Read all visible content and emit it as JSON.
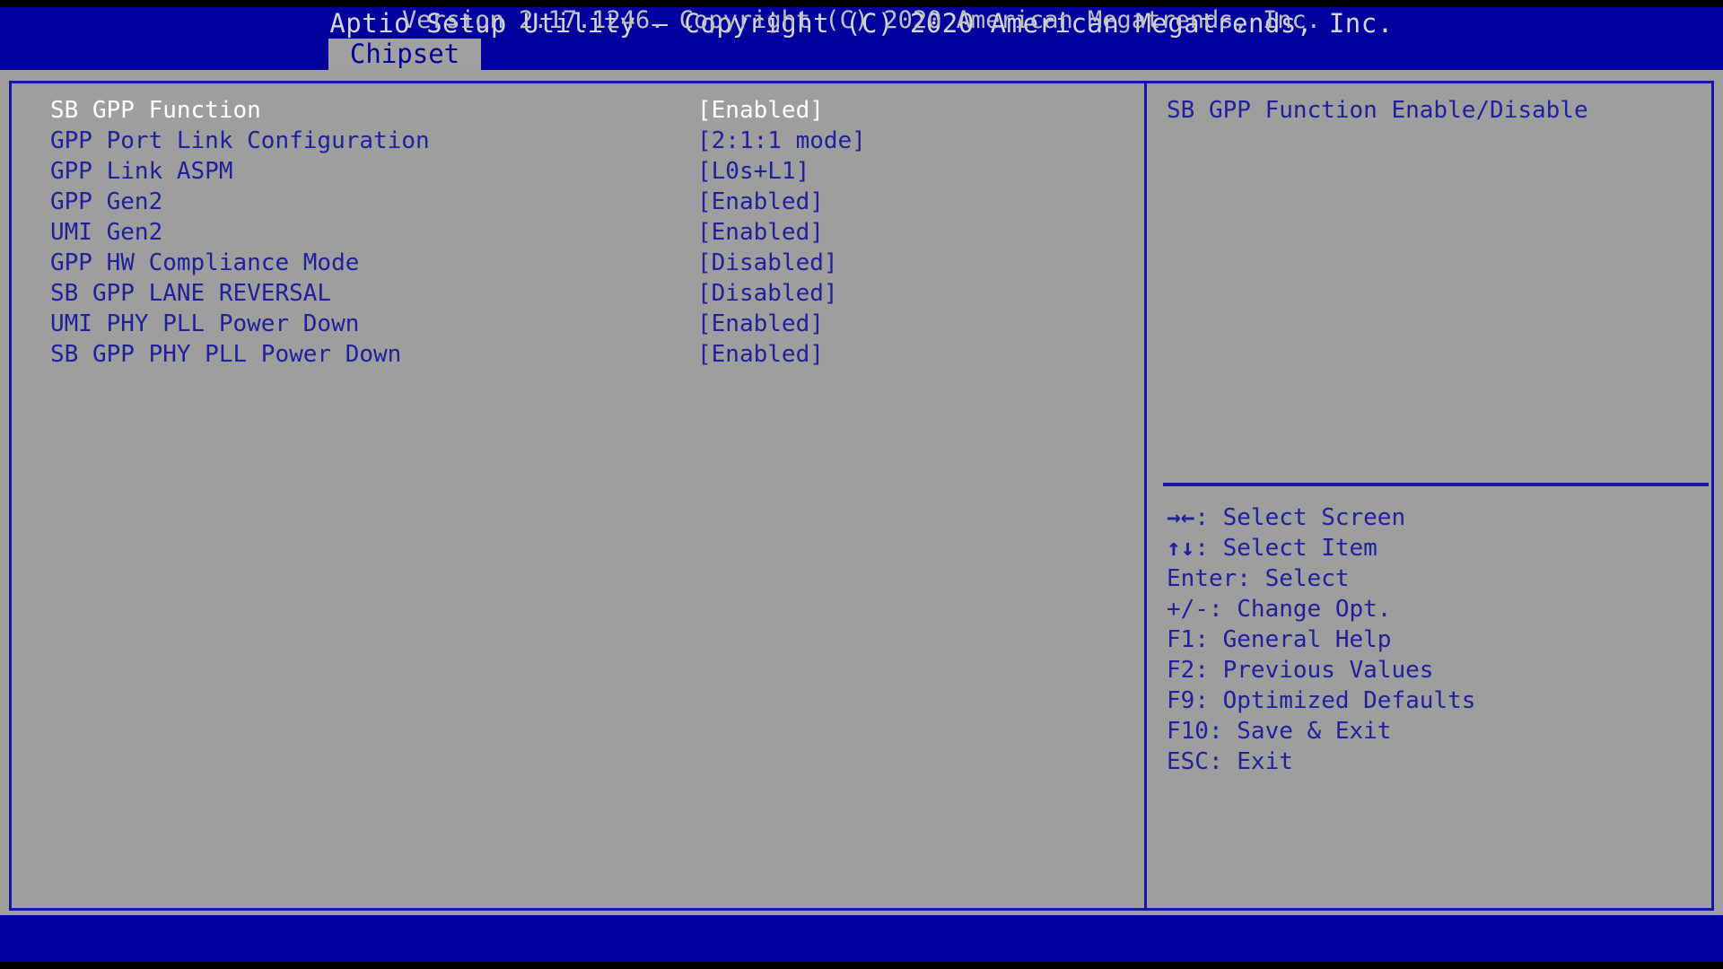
{
  "window": {
    "title": "Aptio Setup Utility – Copyright (C) 2020 American Megatrends, Inc."
  },
  "colors": {
    "header_blue": "#00009c",
    "body_gray": "#9e9e9e",
    "text_blue": "#20209c",
    "selected_white": "#ffffff",
    "tab_gray": "#a0a0a0",
    "border_blue": "#1515a8"
  },
  "tabs": [
    {
      "label": "Chipset",
      "active": true
    }
  ],
  "settings": [
    {
      "label": "SB GPP Function",
      "value": "[Enabled]",
      "selected": true
    },
    {
      "label": "GPP Port Link Configuration",
      "value": "[2:1:1 mode]",
      "selected": false
    },
    {
      "label": "GPP Link ASPM",
      "value": "[L0s+L1]",
      "selected": false
    },
    {
      "label": "GPP Gen2",
      "value": "[Enabled]",
      "selected": false
    },
    {
      "label": "UMI Gen2",
      "value": "[Enabled]",
      "selected": false
    },
    {
      "label": "GPP HW Compliance Mode",
      "value": "[Disabled]",
      "selected": false
    },
    {
      "label": "SB GPP LANE REVERSAL",
      "value": "[Disabled]",
      "selected": false
    },
    {
      "label": "UMI PHY PLL Power Down",
      "value": "[Enabled]",
      "selected": false
    },
    {
      "label": "SB GPP PHY PLL Power Down",
      "value": "[Enabled]",
      "selected": false
    }
  ],
  "help": {
    "text": "SB GPP Function Enable/Disable"
  },
  "legend": [
    {
      "key": "→←",
      "label": ": Select Screen"
    },
    {
      "key": "↑↓",
      "label": ": Select Item"
    },
    {
      "key": "Enter",
      "label": ": Select"
    },
    {
      "key": "+/-",
      "label": ": Change Opt."
    },
    {
      "key": "F1",
      "label": ": General Help"
    },
    {
      "key": "F2",
      "label": ": Previous Values"
    },
    {
      "key": "F9",
      "label": ": Optimized Defaults"
    },
    {
      "key": "F10",
      "label": ": Save & Exit"
    },
    {
      "key": "ESC",
      "label": ": Exit"
    }
  ],
  "footer": {
    "text": "Version 2.17.1246. Copyright (C) 2020 American Megatrends, Inc."
  }
}
